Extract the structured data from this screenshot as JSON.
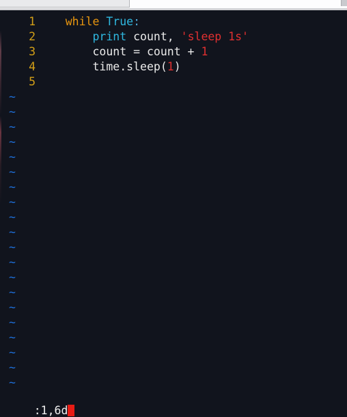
{
  "chrome": {
    "tab_first_label": "",
    "tab_second_label": "",
    "corner_label": ""
  },
  "terminal": {
    "background": "#11141d",
    "foreground": "#e8e8e8",
    "line_number_color": "#d4a017",
    "tilde_color": "#1e6fd9",
    "cursor_color": "#e81c14"
  },
  "editor": {
    "lines": [
      {
        "number": "1",
        "tokens": [
          {
            "text": "    ",
            "kind": "plain"
          },
          {
            "text": "while",
            "kind": "kw"
          },
          {
            "text": " ",
            "kind": "plain"
          },
          {
            "text": "True",
            "kind": "const"
          },
          {
            "text": ":",
            "kind": "punct"
          }
        ]
      },
      {
        "number": "2",
        "tokens": [
          {
            "text": "        ",
            "kind": "plain"
          },
          {
            "text": "print",
            "kind": "func"
          },
          {
            "text": " count, ",
            "kind": "plain"
          },
          {
            "text": "'sleep 1s'",
            "kind": "str"
          }
        ]
      },
      {
        "number": "3",
        "tokens": [
          {
            "text": "        ",
            "kind": "plain"
          },
          {
            "text": "count = count + ",
            "kind": "plain"
          },
          {
            "text": "1",
            "kind": "num"
          }
        ]
      },
      {
        "number": "4",
        "tokens": [
          {
            "text": "        ",
            "kind": "plain"
          },
          {
            "text": "time.sleep(",
            "kind": "plain"
          },
          {
            "text": "1",
            "kind": "num"
          },
          {
            "text": ")",
            "kind": "plain"
          }
        ]
      },
      {
        "number": "5",
        "tokens": []
      }
    ],
    "empty_marker": "~",
    "empty_marker_count": 20
  },
  "status": {
    "command_text": ":1,6d",
    "cursor": "block"
  }
}
